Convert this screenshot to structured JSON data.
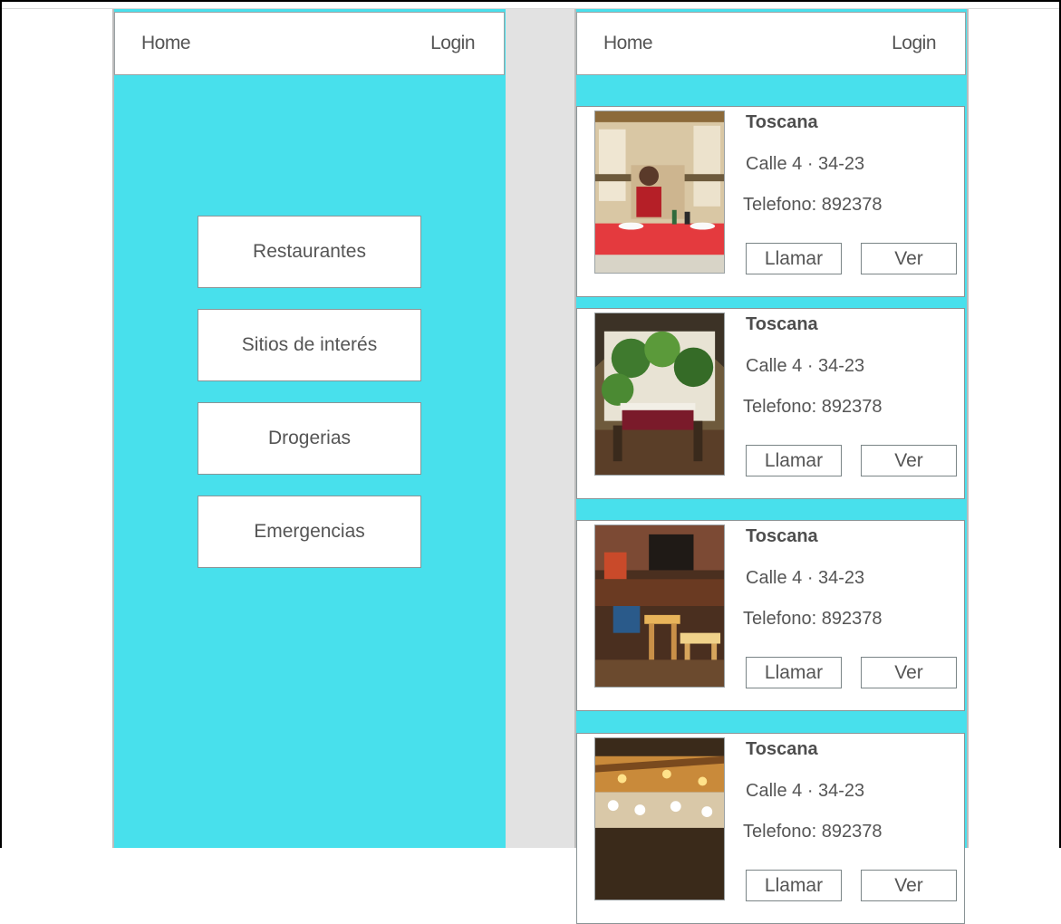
{
  "screens": [
    {
      "nav": {
        "home": "Home",
        "login": "Login"
      },
      "menu": [
        {
          "label": "Restaurantes"
        },
        {
          "label": "Sitios de interés"
        },
        {
          "label": "Drogerias"
        },
        {
          "label": "Emergencias"
        }
      ]
    },
    {
      "nav": {
        "home": "Home",
        "login": "Login"
      },
      "listings": [
        {
          "name": "Toscana",
          "address": "Calle 4 · 34-23",
          "phone": "Telefono: 892378",
          "call_label": "Llamar",
          "view_label": "Ver",
          "photo": "restaurant-photo-dining-woman"
        },
        {
          "name": "Toscana",
          "address": "Calle 4 · 34-23",
          "phone": "Telefono: 892378",
          "call_label": "Llamar",
          "view_label": "Ver",
          "photo": "restaurant-photo-courtyard-plants"
        },
        {
          "name": "Toscana",
          "address": "Calle 4 · 34-23",
          "phone": "Telefono: 892378",
          "call_label": "Llamar",
          "view_label": "Ver",
          "photo": "restaurant-photo-wooden-interior"
        },
        {
          "name": "Toscana",
          "address": "Calle 4 · 34-23",
          "phone": "Telefono: 892378",
          "call_label": "Llamar",
          "view_label": "Ver",
          "photo": "restaurant-photo-banquet-hall"
        }
      ]
    }
  ],
  "colors": {
    "accent": "#48e0ec",
    "gap": "#e2e2e2",
    "border": "#8a9496",
    "text": "#555555"
  }
}
